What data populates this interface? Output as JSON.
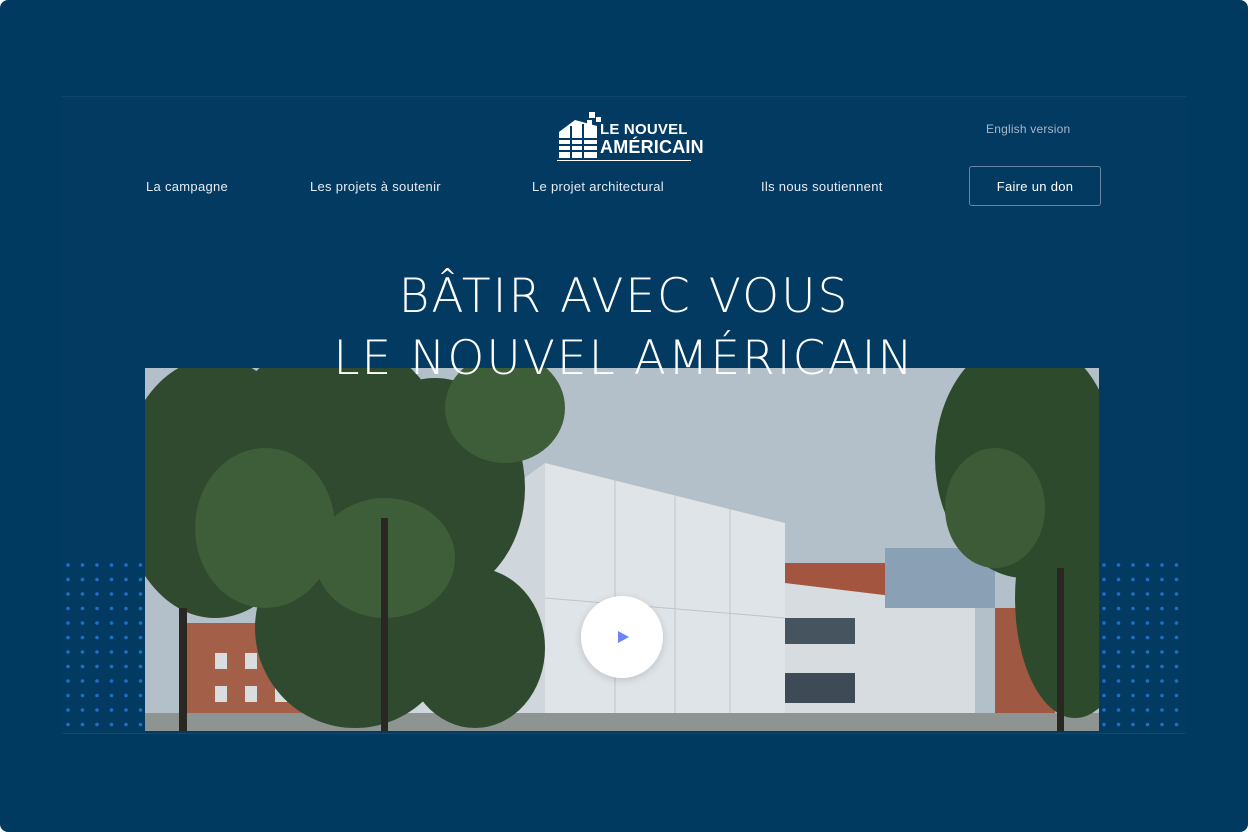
{
  "header": {
    "logo_line1": "LE NOUVEL",
    "logo_line2": "AMÉRICAIN",
    "language_link": "English version"
  },
  "nav": {
    "items": [
      {
        "label": "La campagne"
      },
      {
        "label": "Les projets à soutenir"
      },
      {
        "label": "Le projet architectural"
      },
      {
        "label": "Ils nous soutiennent"
      }
    ],
    "donate_label": "Faire un don"
  },
  "hero": {
    "title_line1": "BÂTIR AVEC VOUS",
    "title_line2": "LE NOUVEL AMÉRICAIN",
    "play_icon": "play-icon"
  },
  "colors": {
    "background": "#013a60",
    "accent": "#1f6fc9",
    "text": "#ffffff"
  }
}
